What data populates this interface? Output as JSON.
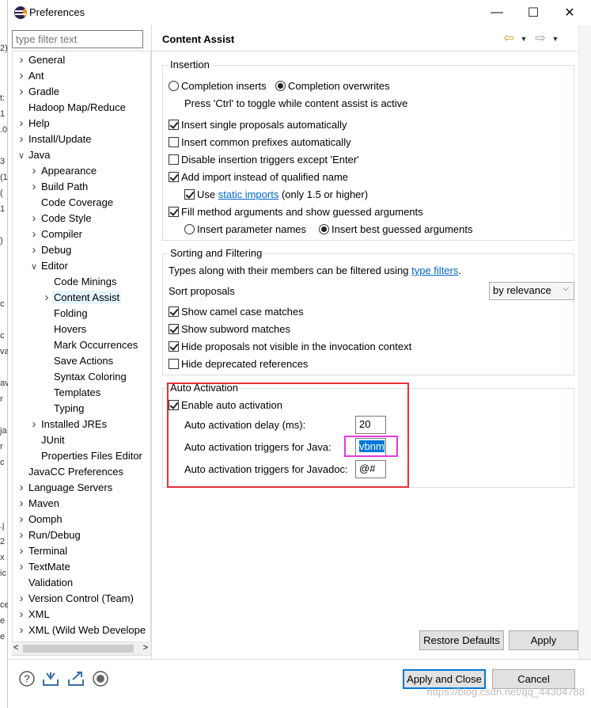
{
  "window": {
    "title": "Preferences",
    "minimize": "—",
    "maximize": "☐",
    "close": "✕"
  },
  "filter": {
    "placeholder": "type filter text"
  },
  "tree": [
    {
      "label": "General",
      "expander": ">",
      "depth": 0
    },
    {
      "label": "Ant",
      "expander": ">",
      "depth": 0
    },
    {
      "label": "Gradle",
      "expander": ">",
      "depth": 0
    },
    {
      "label": "Hadoop Map/Reduce",
      "expander": "",
      "depth": 0
    },
    {
      "label": "Help",
      "expander": ">",
      "depth": 0
    },
    {
      "label": "Install/Update",
      "expander": ">",
      "depth": 0
    },
    {
      "label": "Java",
      "expander": "v",
      "depth": 0
    },
    {
      "label": "Appearance",
      "expander": ">",
      "depth": 1
    },
    {
      "label": "Build Path",
      "expander": ">",
      "depth": 1
    },
    {
      "label": "Code Coverage",
      "expander": "",
      "depth": 1
    },
    {
      "label": "Code Style",
      "expander": ">",
      "depth": 1
    },
    {
      "label": "Compiler",
      "expander": ">",
      "depth": 1
    },
    {
      "label": "Debug",
      "expander": ">",
      "depth": 1
    },
    {
      "label": "Editor",
      "expander": "v",
      "depth": 1
    },
    {
      "label": "Code Minings",
      "expander": "",
      "depth": 2
    },
    {
      "label": "Content Assist",
      "expander": ">",
      "depth": 2,
      "selected": true
    },
    {
      "label": "Folding",
      "expander": "",
      "depth": 2
    },
    {
      "label": "Hovers",
      "expander": "",
      "depth": 2
    },
    {
      "label": "Mark Occurrences",
      "expander": "",
      "depth": 2
    },
    {
      "label": "Save Actions",
      "expander": "",
      "depth": 2
    },
    {
      "label": "Syntax Coloring",
      "expander": "",
      "depth": 2
    },
    {
      "label": "Templates",
      "expander": "",
      "depth": 2
    },
    {
      "label": "Typing",
      "expander": "",
      "depth": 2
    },
    {
      "label": "Installed JREs",
      "expander": ">",
      "depth": 1
    },
    {
      "label": "JUnit",
      "expander": "",
      "depth": 1
    },
    {
      "label": "Properties Files Editor",
      "expander": "",
      "depth": 1
    },
    {
      "label": "JavaCC Preferences",
      "expander": "",
      "depth": 0
    },
    {
      "label": "Language Servers",
      "expander": ">",
      "depth": 0
    },
    {
      "label": "Maven",
      "expander": ">",
      "depth": 0
    },
    {
      "label": "Oomph",
      "expander": ">",
      "depth": 0
    },
    {
      "label": "Run/Debug",
      "expander": ">",
      "depth": 0
    },
    {
      "label": "Terminal",
      "expander": ">",
      "depth": 0
    },
    {
      "label": "TextMate",
      "expander": ">",
      "depth": 0
    },
    {
      "label": "Validation",
      "expander": "",
      "depth": 0
    },
    {
      "label": "Version Control (Team)",
      "expander": ">",
      "depth": 0
    },
    {
      "label": "XML",
      "expander": ">",
      "depth": 0
    },
    {
      "label": "XML (Wild Web Develope",
      "expander": ">",
      "depth": 0
    }
  ],
  "page": {
    "title": "Content Assist",
    "back_icon": "back-arrow-icon",
    "forward_icon": "forward-arrow-icon"
  },
  "insertion": {
    "title": "Insertion",
    "completion_inserts": "Completion inserts",
    "completion_overwrites": "Completion overwrites",
    "toggle_hint": "Press 'Ctrl' to toggle while content assist is active",
    "insert_single": "Insert single proposals automatically",
    "insert_common": "Insert common prefixes automatically",
    "disable_triggers": "Disable insertion triggers except 'Enter'",
    "add_import": "Add import instead of qualified name",
    "use": "Use",
    "static_imports": "static imports",
    "only_15": "(only 1.5 or higher)",
    "fill_method": "Fill method arguments and show guessed arguments",
    "insert_param_names": "Insert parameter names",
    "insert_best_guessed": "Insert best guessed arguments"
  },
  "sorting": {
    "title": "Sorting and Filtering",
    "types_along": "Types along with their members can be filtered using",
    "type_filters": "type filters",
    "period": ".",
    "sort_proposals": "Sort proposals",
    "sort_value": "by relevance",
    "camel_case": "Show camel case matches",
    "subword": "Show subword matches",
    "hide_not_visible": "Hide proposals not visible in the invocation context",
    "hide_deprecated": "Hide deprecated references"
  },
  "auto": {
    "title": "Auto Activation",
    "enable": "Enable auto activation",
    "delay_label": "Auto activation delay (ms):",
    "delay_value": "20",
    "java_label": "Auto activation triggers for Java:",
    "java_value": "vbnm",
    "javadoc_label": "Auto activation triggers for Javadoc:",
    "javadoc_value": "@#"
  },
  "buttons": {
    "restore_defaults": "Restore Defaults",
    "apply": "Apply",
    "apply_and_close": "Apply and Close",
    "cancel": "Cancel"
  },
  "bottom_icons": [
    "help-icon",
    "import-icon",
    "export-icon",
    "record-icon"
  ],
  "watermark": "https://blog.csdn.net/qq_44304788",
  "left_strip": [
    "2)",
    "t:",
    "1",
    ".0",
    "3",
    "(1",
    "(",
    "1",
    ")",
    "c",
    "c",
    "va",
    "av",
    "r",
    "ja",
    "r",
    "c",
    ".j",
    "2",
    "x",
    "ic",
    "ce",
    "e",
    "e"
  ]
}
